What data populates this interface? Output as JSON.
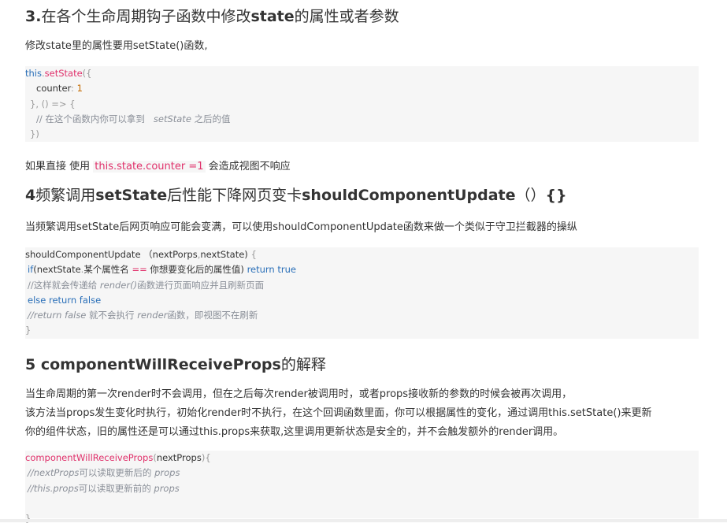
{
  "section1": {
    "title_num": "3.",
    "title_a": "在各个生命周期钩子函数中修改",
    "title_b": "state",
    "title_c": "的属性或者参数",
    "desc": "修改state里的属性要用setState()函数,",
    "code": {
      "l1_this": "this",
      "l1_dot": ".",
      "l1_fn": "setState",
      "l1_p": "({",
      "l2_key": "counter",
      "l2_colon": ": ",
      "l2_val": "1",
      "l3_a": "}, () ",
      "l3_b": "=> {",
      "l4_comment": "// 在这个函数内你可以拿到",
      "l4_fn": "setState",
      "l4_tail": "之后的值",
      "l5": "})"
    },
    "note_prefix": "如果直接 使用 ",
    "note_code": "this.state.counter =1",
    "note_suffix": " 会造成视图不响应"
  },
  "section2": {
    "title_a": "4",
    "title_b": "频繁调用",
    "title_c": "setState",
    "title_d": "后性能下降网页变卡",
    "title_e": "shouldComponentUpdate",
    "title_f": "（）",
    "title_g": "{}",
    "desc": "当频繁调用setState后网页响应可能会变满，可以使用shouldComponentUpdate函数来做一个类似于守卫拦截器的操纵",
    "code": {
      "l1_a": "shouldComponentUpdate （nextPorps",
      "l1_b": ",",
      "l1_c": "nextState)",
      "l1_d": " {",
      "l2_if": "if",
      "l2_a": "(nextState",
      "l2_b": ".",
      "l2_c": "某个属性名",
      "l2_eq": " == ",
      "l2_d": "你想要变化后的属性值",
      "l2_e": ") ",
      "l2_ret": "return true",
      "l3_a": "//这样就会传递给 ",
      "l3_b": "render()",
      "l3_c": "函数进行页面响应并且刷新页面",
      "l4": "else return false",
      "l5_a": "//return false",
      "l5_b": " 就不会执行 ",
      "l5_c": "render",
      "l5_d": "函数，即视图不在刷新",
      "l6": "}"
    }
  },
  "section3": {
    "title_a": "5 ",
    "title_b": "componentWillReceiveProps",
    "title_c": "的解释",
    "para1": "当生命周期的第一次render时不会调用，但在之后每次render被调用时，或者props接收新的参数的时候会被再次调用，",
    "para2": "该方法当props发生变化时执行，初始化render时不执行，在这个回调函数里面，你可以根据属性的变化，通过调用this.setState()来更新",
    "para3": "你的组件状态，旧的属性还是可以通过this.props来获取,这里调用更新状态是安全的，并不会触发额外的render调用。",
    "code": {
      "l1_fn": "componentWillReceiveProps",
      "l1_a": "(",
      "l1_b": "nextProps",
      "l1_c": "){",
      "l2_a": "//nextProps",
      "l2_b": "可以读取更新后的 ",
      "l2_c": "props",
      "l3_a": "//this.props",
      "l3_b": "可以读取更新前的 ",
      "l3_c": "props",
      "l4": "}"
    }
  }
}
